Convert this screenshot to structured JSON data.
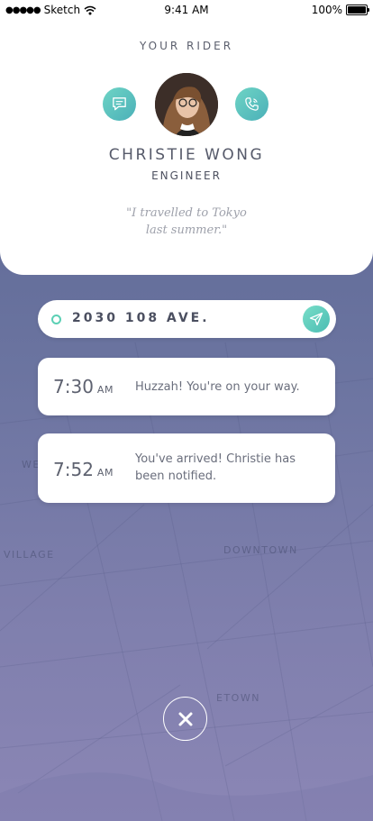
{
  "status_bar": {
    "signal": "●●●●●",
    "carrier": "Sketch",
    "time": "9:41 AM",
    "battery": "100%"
  },
  "rider": {
    "section_label": "YOUR RIDER",
    "name": "CHRISTIE WONG",
    "job": "ENGINEER",
    "quote_line1": "\"I travelled to Tokyo",
    "quote_line2": "last summer.\""
  },
  "address": {
    "value": "2030 108 AVE."
  },
  "events": [
    {
      "time": "7:30",
      "ampm": "AM",
      "message": "Huzzah! You're on your way."
    },
    {
      "time": "7:52",
      "ampm": "AM",
      "message": "You've arrived! Christie has been notified."
    }
  ],
  "map": {
    "labels": [
      "VILLAGE",
      "DOWNTOWN",
      "WE",
      "ETOWN"
    ]
  },
  "colors": {
    "accent": "#5ccfb6",
    "bg_top": "#56628f",
    "bg_bottom": "#8b86b5"
  },
  "icons": {
    "message": "chat-bubble-icon",
    "call": "phone-icon",
    "send": "navigation-arrow-icon",
    "close": "close-icon"
  }
}
